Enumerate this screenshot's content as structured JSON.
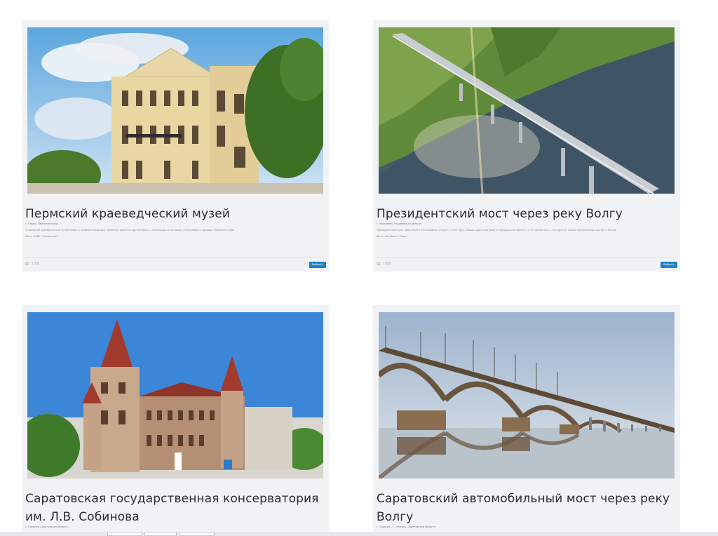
{
  "cards": [
    {
      "title": "Пермский краеведческий музей",
      "location": "г. Пермь, Пермский край",
      "description": "Старейший краеведческий музей Урала в особняке Мешкова, памятник архитектуры XIX века — коллекции по истории, этнографии и природе Пермского края",
      "source": "Фото: ЛАВР / Shutterstock",
      "views": "1 055",
      "select_label": "Выбрать"
    },
    {
      "title": "Президентский мост через реку Волгу",
      "location": "г. Ульяновск, Ульяновская область",
      "description": "Президентский мост через Волгу в Ульяновске открыт в 2009 году. Общая длина мостового перехода составляет 12,97 километра — это один из самых протяжённых мостов в России",
      "source": "Фото: Фотобанк / Лори",
      "views": "1 055",
      "select_label": "Выбрать"
    },
    {
      "title": "Саратовская государственная консерватория им. Л.В. Собинова",
      "location": "г. Саратов, Саратовская область"
    },
    {
      "title": "Саратовский автомобильный мост через реку Волгу",
      "location": "г. Саратов – г. Энгельс, Саратовская область"
    }
  ],
  "colors": {
    "card_bg": "#f1f2f4",
    "accent": "#1f84c5",
    "title": "#2a2d33"
  },
  "icons": {
    "views": "eye-icon"
  }
}
